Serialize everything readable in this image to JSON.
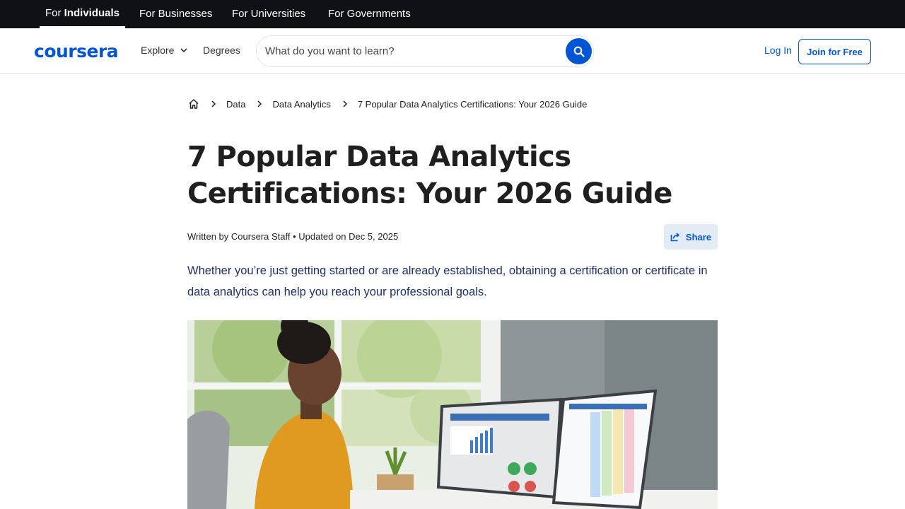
{
  "topbar": {
    "audiences": [
      {
        "prefix": "For ",
        "strong": "Individuals"
      },
      {
        "label": "For Businesses"
      },
      {
        "label": "For Universities"
      },
      {
        "label": "For Governments"
      }
    ]
  },
  "header": {
    "logo": "coursera",
    "explore_label": "Explore",
    "degrees_label": "Degrees",
    "search_placeholder": "What do you want to learn?",
    "login_label": "Log In",
    "join_label": "Join for Free"
  },
  "breadcrumb": [
    "Data",
    "Data Analytics",
    "7 Popular Data Analytics Certifications: Your 2026 Guide"
  ],
  "article": {
    "title": "7 Popular Data Analytics Certifications: Your 2026 Guide",
    "byline": "Written by Coursera Staff • Updated on Dec 5, 2025",
    "share_label": "Share",
    "intro": "Whether you’re just getting started or are already established, obtaining a certification or certificate in data analytics can help you reach your professional goals."
  },
  "colors": {
    "brand": "#0056d2",
    "topbar_bg": "#0f1114",
    "share_bg": "#e3ebf7",
    "intro_text": "#1d3163"
  },
  "icons": [
    "home-icon",
    "chevron-right-icon",
    "chevron-down-icon",
    "search-icon",
    "share-icon"
  ]
}
